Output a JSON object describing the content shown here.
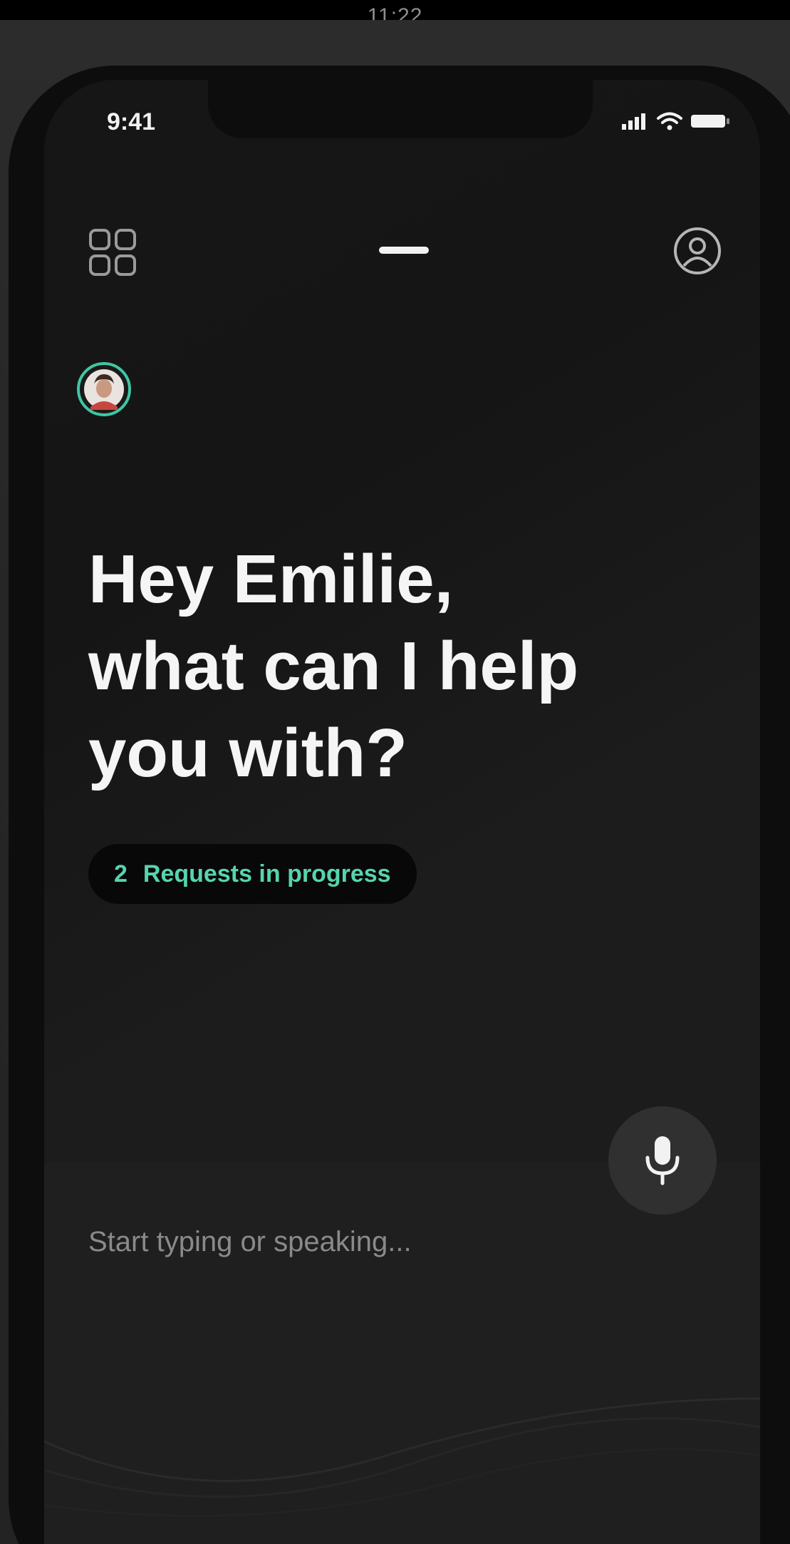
{
  "outer_status": {
    "time": "11:22"
  },
  "status_bar": {
    "time": "9:41",
    "icons": [
      "signal-icon",
      "wifi-icon",
      "battery-icon"
    ]
  },
  "nav": {
    "left_icon": "grid-icon",
    "center_icon": "handle-icon",
    "right_icon": "user-icon"
  },
  "greeting": {
    "lines": [
      "Hey Emilie,",
      "what can I help",
      "you with?"
    ]
  },
  "requests": {
    "count": "2",
    "label": "Requests in progress"
  },
  "input": {
    "placeholder": "Start typing or speaking...",
    "value": ""
  },
  "mic": {
    "icon": "microphone-icon"
  },
  "colors": {
    "accent": "#56d4ae",
    "avatar_ring": "#3fc7a3",
    "background": "#1a1a1a",
    "text": "#f5f5f5"
  }
}
